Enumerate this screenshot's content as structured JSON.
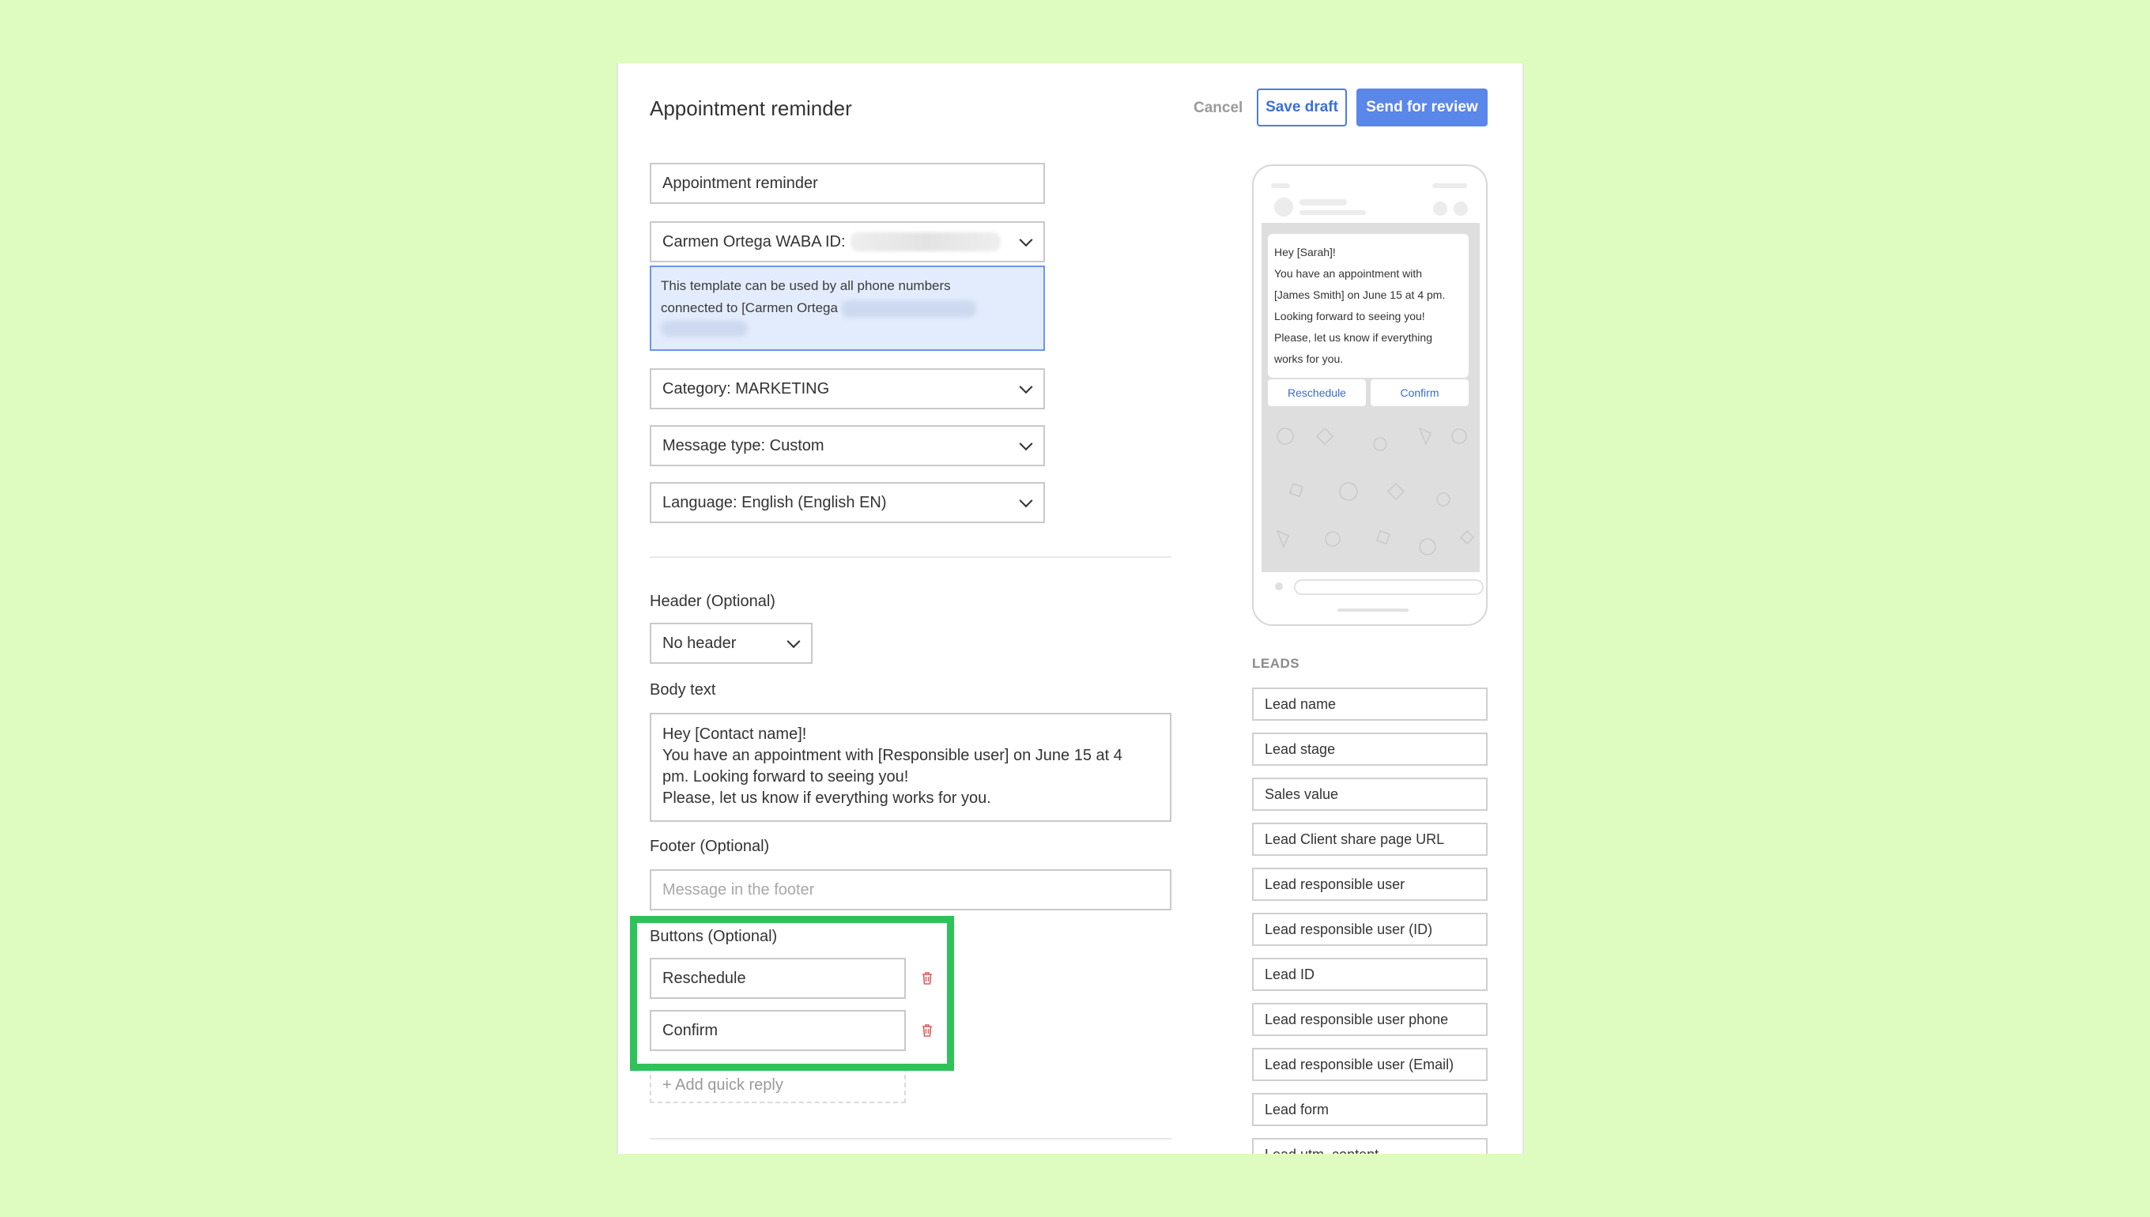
{
  "header": {
    "title": "Appointment reminder",
    "cancel_label": "Cancel",
    "save_draft_label": "Save draft",
    "send_review_label": "Send for review"
  },
  "form": {
    "template_name": "Appointment reminder",
    "account_select": "Carmen Ortega WABA ID:",
    "account_note_line1": "This template can be used by all phone numbers",
    "account_note_line2": "connected to [Carmen Ortega",
    "category": "Category: MARKETING",
    "message_type": "Message type: Custom",
    "language": "Language: English (English EN)",
    "header_label": "Header (Optional)",
    "header_select": "No header",
    "body_label": "Body text",
    "body_text": "Hey [Contact name]!\nYou have an appointment with [Responsible user] on June 15 at 4\npm. Looking forward to seeing you!\nPlease, let us know if everything works for you.",
    "footer_label": "Footer (Optional)",
    "footer_placeholder": "Message in the footer",
    "buttons_label": "Buttons (Optional)",
    "buttons": [
      "Reschedule",
      "Confirm"
    ],
    "add_quick_reply": "+ Add quick reply"
  },
  "preview": {
    "lines": [
      "Hey [Sarah]!",
      "You have an appointment with",
      "[James Smith] on June 15 at 4 pm.",
      "Looking forward to seeing you!",
      "Please, let us know if everything",
      "works for you."
    ],
    "buttons": [
      "Reschedule",
      "Confirm"
    ]
  },
  "leads": {
    "title": "LEADS",
    "items": [
      "Lead name",
      "Lead stage",
      "Sales value",
      "Lead Client share page URL",
      "Lead responsible user",
      "Lead responsible user (ID)",
      "Lead ID",
      "Lead responsible user phone",
      "Lead responsible user (Email)",
      "Lead form",
      "Lead utm_content"
    ]
  },
  "colors": {
    "background": "#dffcc0",
    "accent": "#5b86ea",
    "highlight": "#2fc25b",
    "delete": "#e05a5a"
  }
}
